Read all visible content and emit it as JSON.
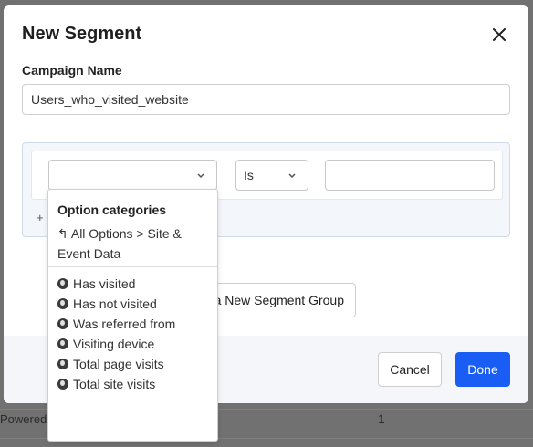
{
  "background": {
    "footer_text": "Powered",
    "count": "1"
  },
  "modal": {
    "title": "New Segment",
    "campaign_name_label": "Campaign Name",
    "campaign_name_value": "Users_who_visited_website",
    "condition": {
      "category_value": "",
      "operator_value": "Is",
      "value_input": ""
    },
    "add_condition_label": "+",
    "add_group_label": "a New Segment Group",
    "cancel_label": "Cancel",
    "done_label": "Done"
  },
  "dropdown": {
    "header": "Option categories",
    "back_label": "All Options > Site & Event Data",
    "options": [
      {
        "label": "Has visited",
        "icon": "globe-icon"
      },
      {
        "label": "Has not visited",
        "icon": "globe-icon"
      },
      {
        "label": "Was referred from",
        "icon": "globe-icon"
      },
      {
        "label": "Visiting device",
        "icon": "globe-icon"
      },
      {
        "label": "Total page visits",
        "icon": "globe-icon"
      },
      {
        "label": "Total site visits",
        "icon": "globe-icon"
      }
    ]
  },
  "colors": {
    "primary": "#1a5df5",
    "overlay": "#717171"
  }
}
